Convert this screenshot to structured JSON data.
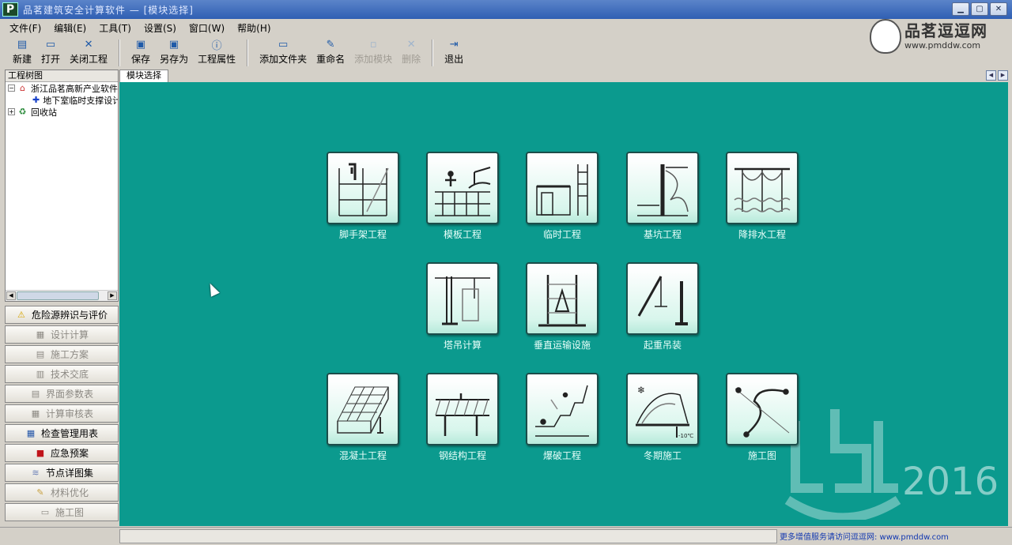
{
  "window": {
    "app_icon": "P",
    "title": "品茗建筑安全计算软件 — [模块选择]",
    "buttons": [
      "minimize",
      "maximize",
      "close"
    ]
  },
  "menu": [
    "文件(F)",
    "编辑(E)",
    "工具(T)",
    "设置(S)",
    "窗口(W)",
    "帮助(H)"
  ],
  "toolbar": [
    {
      "label": "新建",
      "icon": "new-file-icon",
      "enabled": true
    },
    {
      "label": "打开",
      "icon": "open-folder-icon",
      "enabled": true
    },
    {
      "label": "关闭工程",
      "icon": "close-x-icon",
      "enabled": true
    },
    {
      "label": "保存",
      "icon": "save-disk-icon",
      "enabled": true
    },
    {
      "label": "另存为",
      "icon": "save-as-icon",
      "enabled": true
    },
    {
      "label": "工程属性",
      "icon": "info-icon",
      "enabled": true
    },
    {
      "label": "添加文件夹",
      "icon": "add-folder-icon",
      "enabled": true
    },
    {
      "label": "重命名",
      "icon": "rename-icon",
      "enabled": true
    },
    {
      "label": "添加模块",
      "icon": "add-module-icon",
      "enabled": false
    },
    {
      "label": "删除",
      "icon": "delete-x-icon",
      "enabled": false
    },
    {
      "label": "退出",
      "icon": "exit-icon",
      "enabled": true
    }
  ],
  "brand": {
    "name": "品茗逗逗网",
    "url": "www.pmddw.com"
  },
  "tree": {
    "header": "工程树图",
    "items": [
      {
        "label": "浙江品茗高新产业软件",
        "level": 0,
        "expander": "−",
        "icon": "house-icon"
      },
      {
        "label": "地下室临时支撑设计",
        "level": 1,
        "expander": "",
        "icon": "plus-cross-icon"
      },
      {
        "label": "回收站",
        "level": 0,
        "expander": "+",
        "icon": "recycle-bin-icon"
      }
    ]
  },
  "side_buttons": [
    {
      "label": "危险源辨识与评价",
      "icon": "warning-icon",
      "enabled": true
    },
    {
      "label": "设计计算",
      "icon": "calc-icon",
      "enabled": false
    },
    {
      "label": "施工方案",
      "icon": "plan-icon",
      "enabled": false
    },
    {
      "label": "技术交底",
      "icon": "disclosure-icon",
      "enabled": false
    },
    {
      "label": "界面参数表",
      "icon": "param-table-icon",
      "enabled": false
    },
    {
      "label": "计算审核表",
      "icon": "audit-table-icon",
      "enabled": false
    },
    {
      "label": "检查管理用表",
      "icon": "checklist-icon",
      "enabled": true
    },
    {
      "label": "应急预案",
      "icon": "emergency-book-icon",
      "enabled": true
    },
    {
      "label": "节点详图集",
      "icon": "detail-stack-icon",
      "enabled": true
    },
    {
      "label": "材料优化",
      "icon": "material-icon",
      "enabled": false
    },
    {
      "label": "施工图",
      "icon": "drawing-icon",
      "enabled": false
    }
  ],
  "tab": {
    "label": "模块选择"
  },
  "modules": [
    {
      "label": "脚手架工程",
      "icon": "scaffold-icon"
    },
    {
      "label": "模板工程",
      "icon": "formwork-icon"
    },
    {
      "label": "临时工程",
      "icon": "temporary-works-icon"
    },
    {
      "label": "基坑工程",
      "icon": "foundation-pit-icon"
    },
    {
      "label": "降排水工程",
      "icon": "dewatering-icon"
    },
    {
      "label": "塔吊计算",
      "icon": "tower-crane-icon"
    },
    {
      "label": "垂直运输设施",
      "icon": "vertical-transport-icon"
    },
    {
      "label": "起重吊装",
      "icon": "hoisting-icon"
    },
    {
      "label": "混凝土工程",
      "icon": "concrete-icon"
    },
    {
      "label": "钢结构工程",
      "icon": "steel-structure-icon"
    },
    {
      "label": "爆破工程",
      "icon": "blasting-icon"
    },
    {
      "label": "冬期施工",
      "icon": "winter-construction-icon"
    },
    {
      "label": "施工图",
      "icon": "construction-drawing-icon"
    }
  ],
  "watermark": {
    "year": "2016",
    "logo": "csc-logo"
  },
  "statusbar": {
    "message": "更多增值服务请访问逗逗网: www.pmddw.com"
  }
}
